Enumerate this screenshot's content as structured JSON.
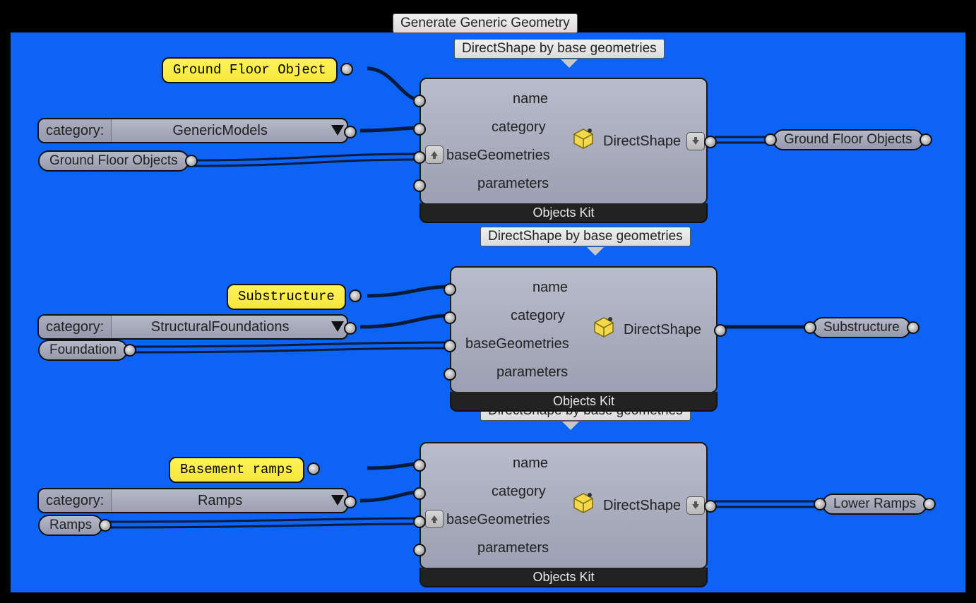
{
  "header": {
    "title": "Generate Generic Geometry",
    "node_label": "DirectShape by base geometries"
  },
  "nodes": {
    "n1": {
      "footer": "Objects Kit",
      "inputs": {
        "name": "name",
        "category": "category",
        "baseGeometries": "baseGeometries",
        "parameters": "parameters"
      },
      "output": "DirectShape"
    },
    "n2": {
      "footer": "Objects Kit",
      "inputs": {
        "name": "name",
        "category": "category",
        "baseGeometries": "baseGeometries",
        "parameters": "parameters"
      },
      "output": "DirectShape"
    },
    "n3": {
      "footer": "Objects Kit",
      "inputs": {
        "name": "name",
        "category": "category",
        "baseGeometries": "baseGeometries",
        "parameters": "parameters"
      },
      "output": "DirectShape"
    }
  },
  "inputs": {
    "yellow1": "Ground Floor Object",
    "yellow2": "Substructure",
    "yellow3": "Basement ramps",
    "cat_label": "category:",
    "cat1_val": "GenericModels",
    "cat2_val": "StructuralFoundations",
    "cat3_val": "Ramps",
    "pill1": "Ground Floor Objects",
    "pill2": "Foundation",
    "pill3": "Ramps"
  },
  "outputs": {
    "out1": "Ground Floor Objects",
    "out2": "Substructure",
    "out3": "Lower Ramps"
  }
}
